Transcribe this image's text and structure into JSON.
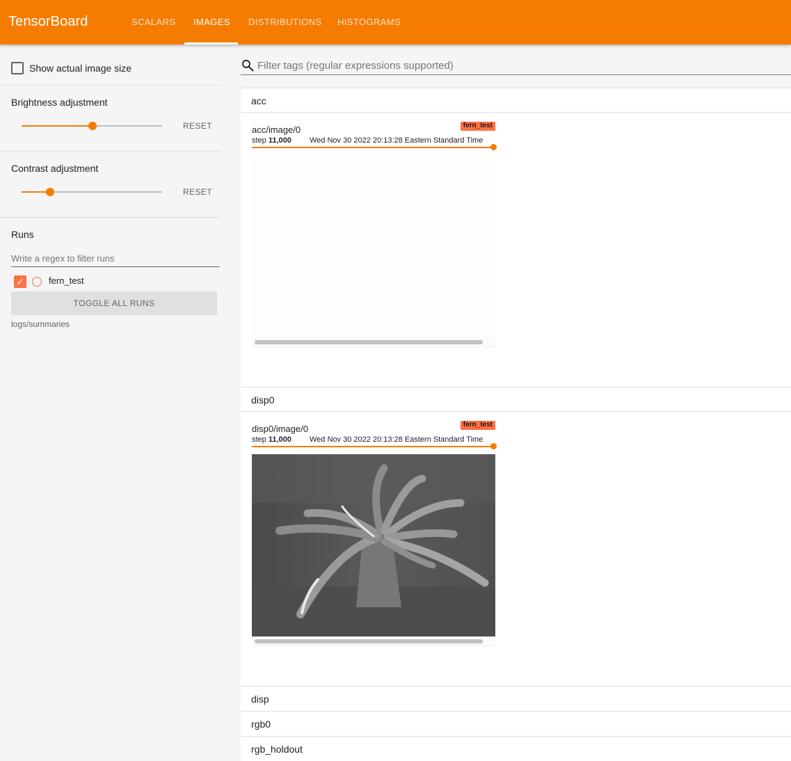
{
  "app": {
    "title": "TensorBoard",
    "tabs": [
      {
        "label": "SCALARS",
        "active": false
      },
      {
        "label": "IMAGES",
        "active": true
      },
      {
        "label": "DISTRIBUTIONS",
        "active": false
      },
      {
        "label": "HISTOGRAMS",
        "active": false
      }
    ],
    "accent_color": "#f57c00",
    "run_color": "#ff7043"
  },
  "sidebar": {
    "show_actual_size": {
      "label": "Show actual image size",
      "checked": false
    },
    "brightness": {
      "title": "Brightness adjustment",
      "reset_label": "RESET",
      "level": 0.5
    },
    "contrast": {
      "title": "Contrast adjustment",
      "reset_label": "RESET",
      "level": 0.2
    },
    "runs": {
      "title": "Runs",
      "filter_placeholder": "Write a regex to filter runs",
      "items": [
        {
          "name": "fern_test",
          "checked": true
        }
      ],
      "toggle_label": "TOGGLE ALL RUNS",
      "logdir": "logs/summaries"
    }
  },
  "main": {
    "search_placeholder": "Filter tags (regular expressions supported)",
    "groups": [
      {
        "name": "acc",
        "card": {
          "tag": "acc/image/0",
          "run": "fern_test",
          "step_label": "step",
          "step_value": "11,000",
          "time": "Wed Nov 30 2022 20:13:28 Eastern Standard Time",
          "step_progress": 1.0,
          "image": "blank-white-image"
        }
      },
      {
        "name": "disp0",
        "card": {
          "tag": "disp0/image/0",
          "run": "fern_test",
          "step_label": "step",
          "step_value": "11,000",
          "time": "Wed Nov 30 2022 20:13:28 Eastern Standard Time",
          "step_progress": 1.0,
          "image": "grayscale-fern-disparity-map"
        }
      },
      {
        "name": "disp"
      },
      {
        "name": "rgb0"
      },
      {
        "name": "rgb_holdout"
      }
    ]
  }
}
